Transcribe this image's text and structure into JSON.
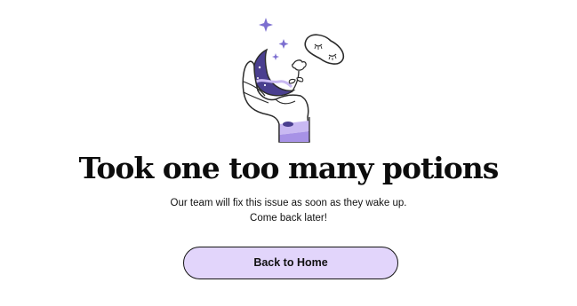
{
  "error": {
    "title": "Took one too many potions",
    "message_line1": "Our team will fix this issue as soon as they wake up.",
    "message_line2": "Come back later!",
    "home_button_label": "Back to Home"
  },
  "colors": {
    "accent_lavender": "#e2d5fb",
    "illustration_purple": "#7c6fd0",
    "illustration_lilac": "#c9b9f2",
    "ink": "#111111"
  },
  "icons": {
    "illustration": "hand-holding-moon-sleep-mask-illustration"
  }
}
